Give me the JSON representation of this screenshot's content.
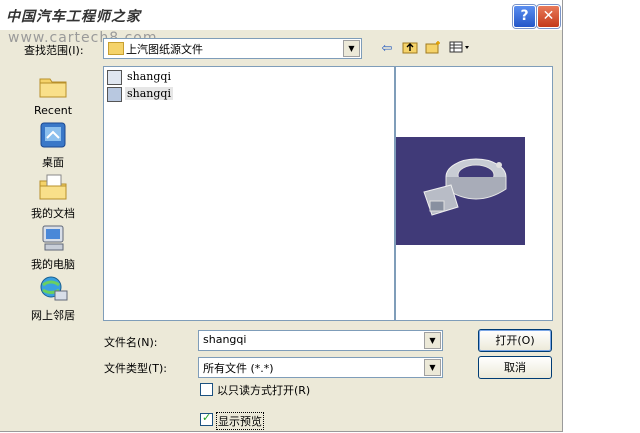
{
  "window": {
    "title": "中国汽车工程师之家",
    "watermark": "www.cartech8.com",
    "help_label": "?",
    "close_label": "✕"
  },
  "lookin": {
    "label": "查找范围(I):",
    "value": "上汽图纸源文件"
  },
  "toolbar": [
    "back-icon",
    "up-folder-icon",
    "new-folder-icon",
    "view-menu-icon"
  ],
  "places": [
    {
      "label": "Recent",
      "icon": "recent-folder-icon"
    },
    {
      "label": "桌面",
      "icon": "desktop-icon"
    },
    {
      "label": "我的文档",
      "icon": "my-documents-icon"
    },
    {
      "label": "我的电脑",
      "icon": "my-computer-icon"
    },
    {
      "label": "网上邻居",
      "icon": "network-places-icon"
    }
  ],
  "files": [
    {
      "name": "shangqi",
      "selected": false
    },
    {
      "name": "shangqi",
      "selected": true
    }
  ],
  "filename": {
    "label": "文件名(N):",
    "value": "shangqi"
  },
  "filetype": {
    "label": "文件类型(T):",
    "value": "所有文件 (*.*)"
  },
  "readonly": {
    "label": "以只读方式打开(R)",
    "checked": false
  },
  "preview_opt": {
    "label": "显示预览",
    "checked": true
  },
  "buttons": {
    "open": "打开(O)",
    "cancel": "取消"
  },
  "colors": {
    "dialog_bg": "#ece9d8",
    "preview_bg": "#403a78",
    "field_border": "#7f9db9"
  }
}
